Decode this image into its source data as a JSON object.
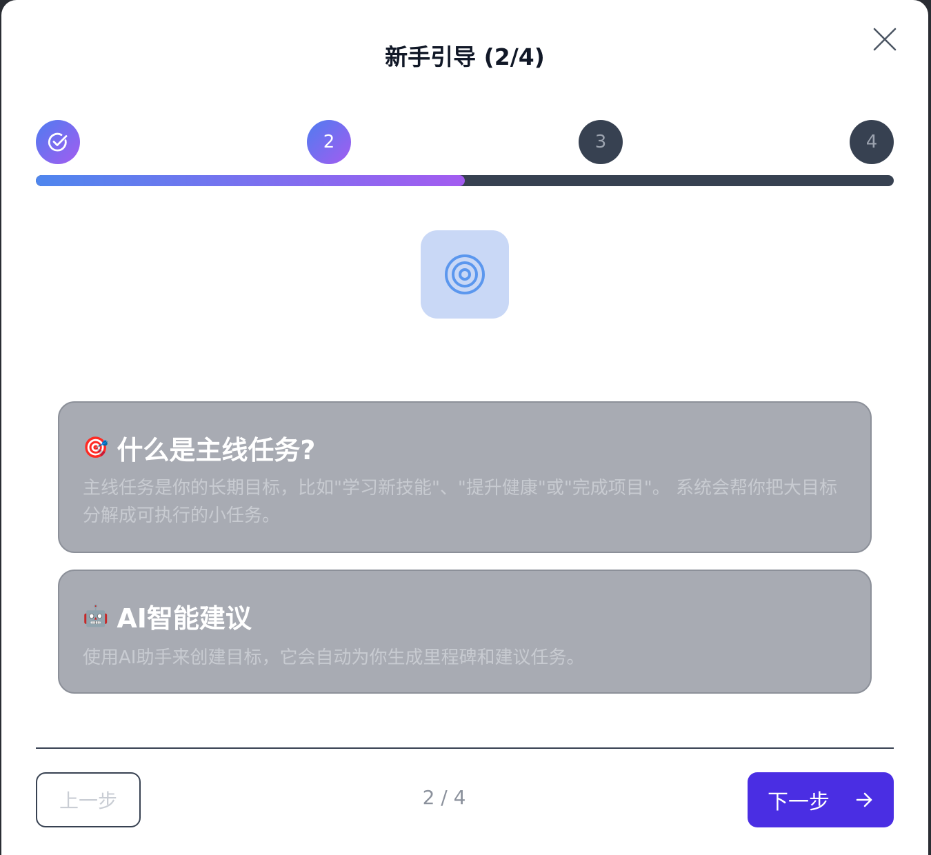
{
  "dialog": {
    "title": "新手引导 (2/4)"
  },
  "steps": [
    {
      "label": "",
      "state": "completed",
      "icon": "check-circle-icon"
    },
    {
      "label": "2",
      "state": "current"
    },
    {
      "label": "3",
      "state": "upcoming"
    },
    {
      "label": "4",
      "state": "upcoming"
    }
  ],
  "progress": {
    "percent": 50
  },
  "hero_icon": "target-icon",
  "cards": [
    {
      "emoji": "🎯",
      "title": "什么是主线任务?",
      "description": "主线任务是你的长期目标，比如\"学习新技能\"、\"提升健康\"或\"完成项目\"。 系统会帮你把大目标分解成可执行的小任务。"
    },
    {
      "emoji": "🤖",
      "title": "AI智能建议",
      "description": "使用AI助手来创建目标，它会自动为你生成里程碑和建议任务。"
    }
  ],
  "footer": {
    "prev_label": "上一步",
    "page_indicator": "2 / 4",
    "next_label": "下一步"
  },
  "colors": {
    "accent_start": "#4f7cf0",
    "accent_end": "#a35cf0",
    "primary_button": "#4a2ee3",
    "track": "#374151"
  }
}
